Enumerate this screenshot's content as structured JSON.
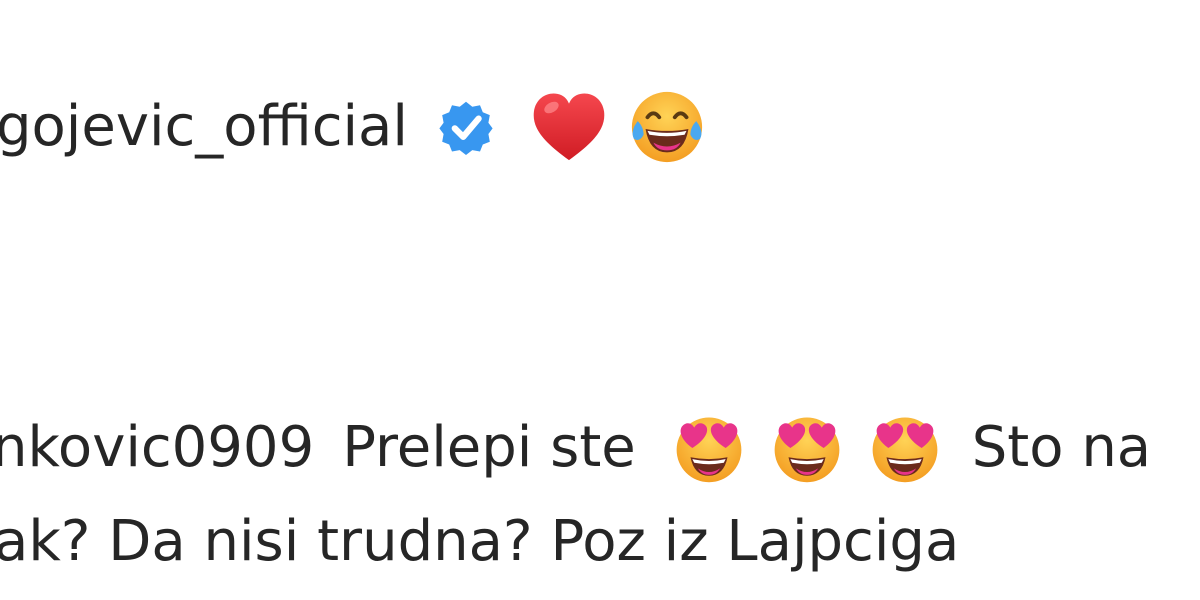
{
  "comments": [
    {
      "username": "gojevic_official",
      "verified_icon": "verified-badge-icon",
      "emojis": [
        "red-heart-icon",
        "tears-of-joy-icon"
      ]
    },
    {
      "username": "nkovic0909",
      "text_before": "Prelepi ste",
      "emojis": [
        "heart-eyes-icon",
        "heart-eyes-icon",
        "heart-eyes-icon"
      ],
      "text_after": "Sto na",
      "text_line2": "ak? Da nisi trudna? Poz iz Lajpciga"
    }
  ],
  "colors": {
    "text": "#262626",
    "verified_blue": "#3897f0",
    "heart_red": "#e8232c",
    "emoji_yellow": "#f7b52c",
    "emoji_pink": "#e8348a"
  }
}
